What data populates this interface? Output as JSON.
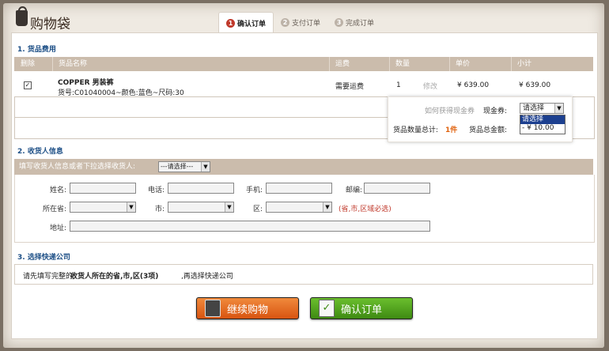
{
  "header": {
    "title": "购物袋"
  },
  "steps": [
    {
      "num": "1",
      "label": "确认订单"
    },
    {
      "num": "2",
      "label": "支付订单"
    },
    {
      "num": "3",
      "label": "完成订单"
    }
  ],
  "section1": {
    "title": "1. 货品费用",
    "columns": [
      "删除",
      "货品名称",
      "运费",
      "数量",
      "单价",
      "小计"
    ],
    "item": {
      "name": "COPPER 男装裤",
      "detail": "货号:C01040004~颜色:蓝色~尺码:30",
      "shipping": "需要运费",
      "qty": "1",
      "edit": "修改",
      "price": "¥ 639.00",
      "subtotal": "¥ 639.00"
    },
    "summary": {
      "coupon_help": "如何获得现金券",
      "coupon_label": "现金券:",
      "coupon_selected": "请选择",
      "coupon_options": [
        "请选择",
        "- ¥ 10.00"
      ],
      "count_label": "货品数量总计:",
      "count_value": "1件",
      "total_label": "货品总金额:"
    }
  },
  "section2": {
    "title": "2. 收货人信息",
    "hint": "填写收货人信息或者下拉选择收货人:",
    "select_receiver": "---请选择---",
    "labels": {
      "name": "姓名:",
      "phone": "电话:",
      "mobile": "手机:",
      "zip": "邮编:",
      "province": "所在省:",
      "city": "市:",
      "district": "区:",
      "address": "地址:"
    },
    "required_note": "(省,市,区域必选)"
  },
  "section3": {
    "title": "3. 选择快递公司",
    "note_prefix": "请先填写完整的",
    "note_bold": "收货人所在的省,市,区(3项)",
    "note_suffix": ",再选择快递公司"
  },
  "buttons": {
    "continue": "继续购物",
    "confirm": "确认订单"
  },
  "colors": {
    "section_title": "#1d4f86",
    "accent_red": "#c0392b",
    "table_header": "#cbbcac",
    "orange_btn": "#e2661b",
    "green_btn": "#4a9a1a"
  }
}
